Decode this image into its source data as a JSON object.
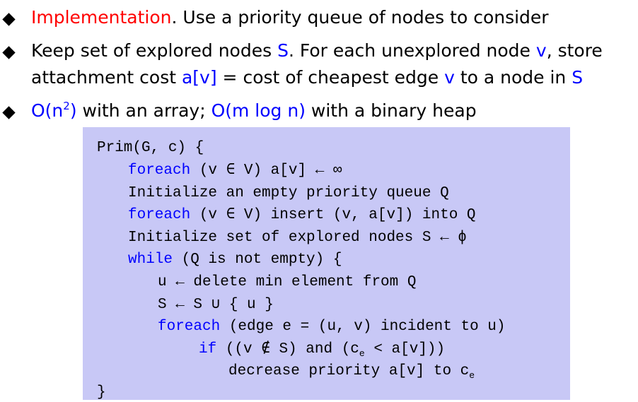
{
  "bullets": [
    {
      "parts": {
        "a": "Implementation",
        "b": ".  Use a priority queue of nodes to consider"
      }
    },
    {
      "parts": {
        "a": "Keep set of explored nodes ",
        "b": "S",
        "c": ".  For each unexplored node ",
        "d": "v",
        "e": ", store"
      }
    },
    {
      "parts": {
        "a": "attachment cost ",
        "b": "a[v]",
        "c": " = cost of cheapest edge ",
        "d": "v",
        "e": " to a node in ",
        "f": "S"
      }
    },
    {
      "parts": {
        "a": "O(n",
        "sup": "2",
        "b": ")",
        "c": " with an array; ",
        "d": "O(m log n)",
        "e": " with a binary heap"
      }
    }
  ],
  "code": {
    "l1": "Prim(G, c) {",
    "l2_kw": "foreach",
    "l2": " (v ∈ V) a[v] ← ∞",
    "l3": "Initialize an empty priority queue Q",
    "l4_kw": "foreach",
    "l4": " (v ∈ V) insert (v, a[v]) into Q",
    "l5": "Initialize set of explored nodes S ← ϕ",
    "l6_kw": "while",
    "l6": " (Q is not empty) {",
    "l7": "u ← delete min element from Q",
    "l8": "S ← S ∪ { u }",
    "l9_kw": "foreach",
    "l9": " (edge e = (u, v) incident to u)",
    "l10_kw": "if",
    "l10a": " ((v ∉ S) and (c",
    "l10sub": "e",
    "l10b": " < a[v]))",
    "l11a": "decrease priority a[v] to c",
    "l11sub": "e",
    "l12": "}"
  }
}
